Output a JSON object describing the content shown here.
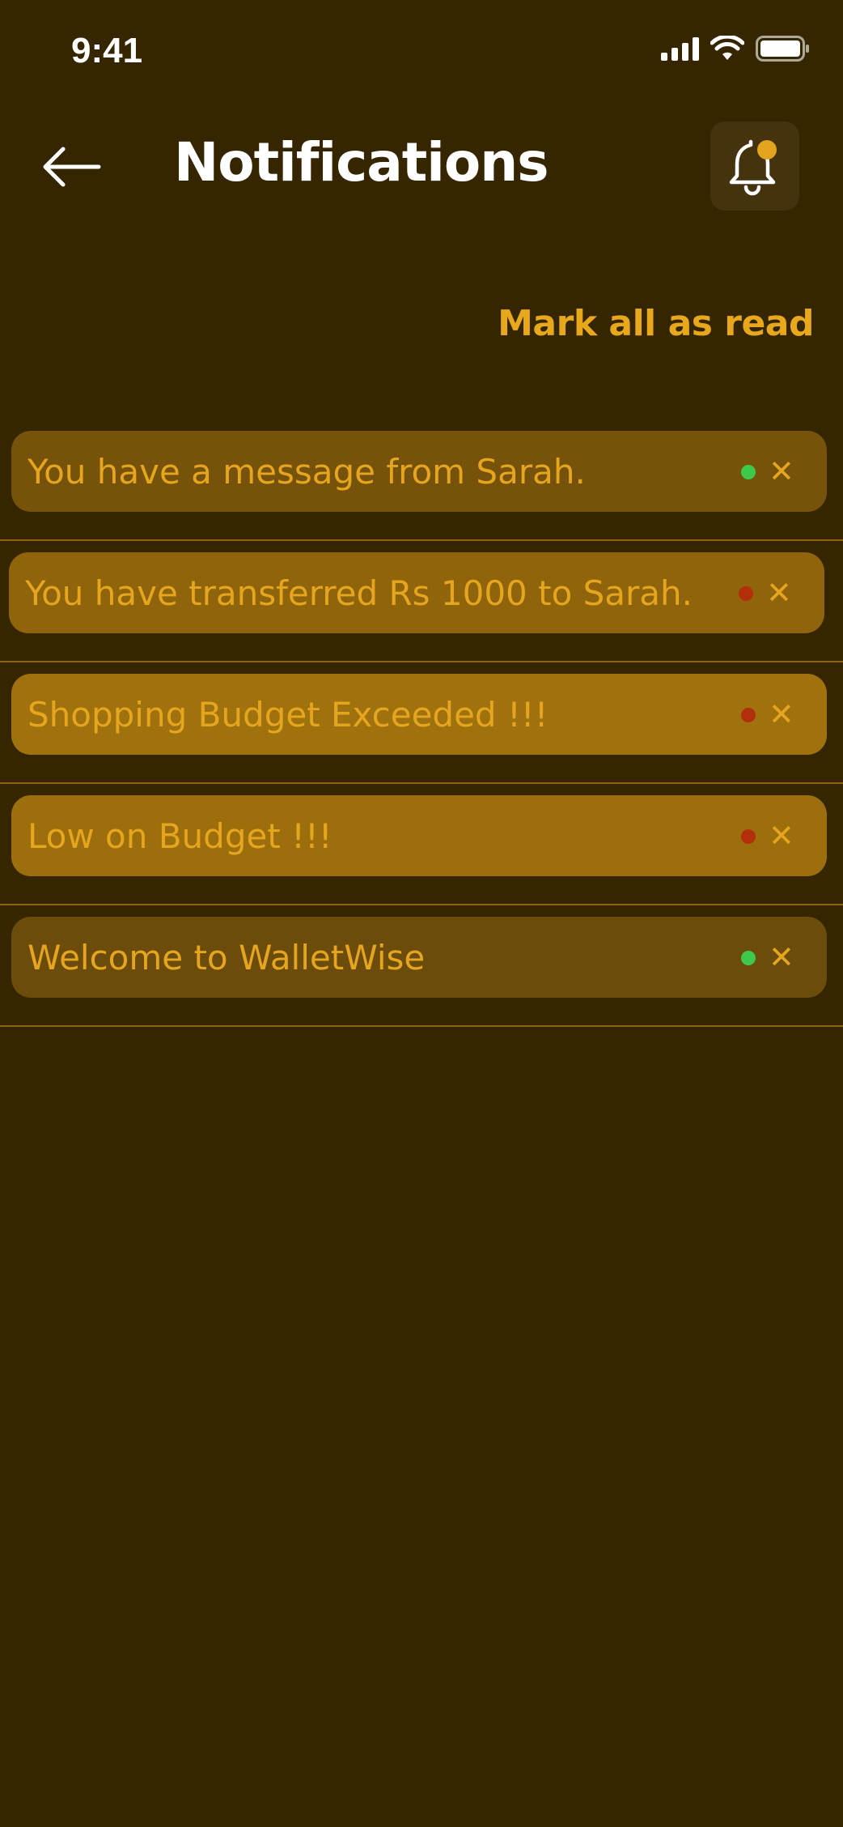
{
  "status_bar": {
    "time": "9:41"
  },
  "header": {
    "title": "Notifications",
    "back_icon": "arrow-left-icon",
    "bell_icon": "bell-with-badge-icon"
  },
  "actions": {
    "mark_all_label": "Mark all as read"
  },
  "colors": {
    "background": "#362600",
    "accent": "#e8a81c",
    "unread_dot": "#3fc94a",
    "read_dot": "#b32f0b"
  },
  "notifications": [
    {
      "text": "You have a message from Sarah.",
      "status": "green",
      "card_color": "#76520a"
    },
    {
      "text": "You have transferred Rs 1000 to Sarah.",
      "status": "red",
      "card_color": "#8f640b"
    },
    {
      "text": "Shopping Budget Exceeded !!!",
      "status": "red",
      "card_color": "#a0720d"
    },
    {
      "text": "Low on Budget !!!",
      "status": "red",
      "card_color": "#9c6f0c"
    },
    {
      "text": "Welcome to WalletWise",
      "status": "green",
      "card_color": "#6b4c0a"
    }
  ]
}
